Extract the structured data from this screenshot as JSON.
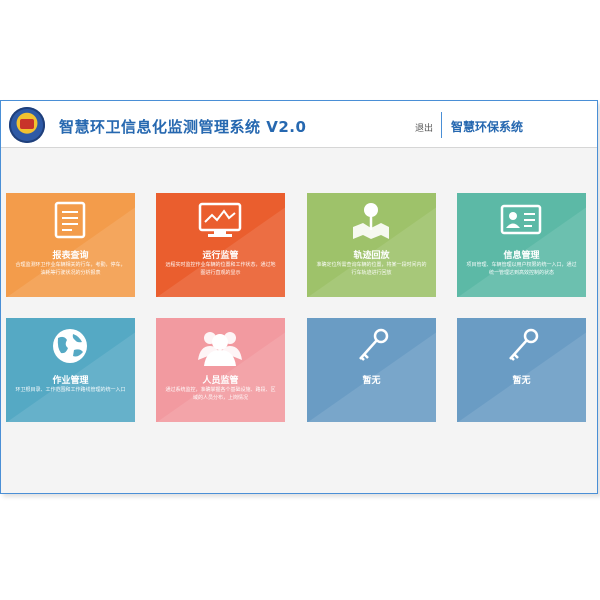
{
  "header": {
    "title": "智慧环卫信息化监测管理系统 V2.0",
    "logout": "退出",
    "system_name": "智慧环保系统"
  },
  "tiles": [
    {
      "title": "报表查询",
      "desc": "合理监测环卫作业车辆相关的行车，考勤，停车，油耗等行驶状况的分析报表",
      "color": "#f39c4b"
    },
    {
      "title": "运行监管",
      "desc": "远程实时监控作业车辆的位置和工作状态，通过地图进行直观的显示",
      "color": "#ea5e2e"
    },
    {
      "title": "轨迹回放",
      "desc": "准确定位所需查询车辆的位置，将某一段时间内的行车轨迹进行回放",
      "color": "#9ec26a"
    },
    {
      "title": "信息管理",
      "desc": "项目管理、车辆管理以用户权限的统一入口，通过统一管理达到高效控制的状态",
      "color": "#5cb9a6"
    },
    {
      "title": "作业管理",
      "desc": "环卫根目录、工作范围和工作路线管理的统一入口",
      "color": "#55a9c4"
    },
    {
      "title": "人员监管",
      "desc": "通过系统监控，准确掌握各个基础设施、路段、区域的人员分布，上岗情况",
      "color": "#f29aa0"
    },
    {
      "title": "暂无",
      "desc": "",
      "color": "#6a9cc4"
    },
    {
      "title": "暂无",
      "desc": "",
      "color": "#6a9cc4"
    }
  ],
  "icons": [
    "document-icon",
    "monitor-chart-icon",
    "map-pin-icon",
    "id-card-icon",
    "globe-icon",
    "people-icon",
    "key-icon",
    "key-icon"
  ]
}
